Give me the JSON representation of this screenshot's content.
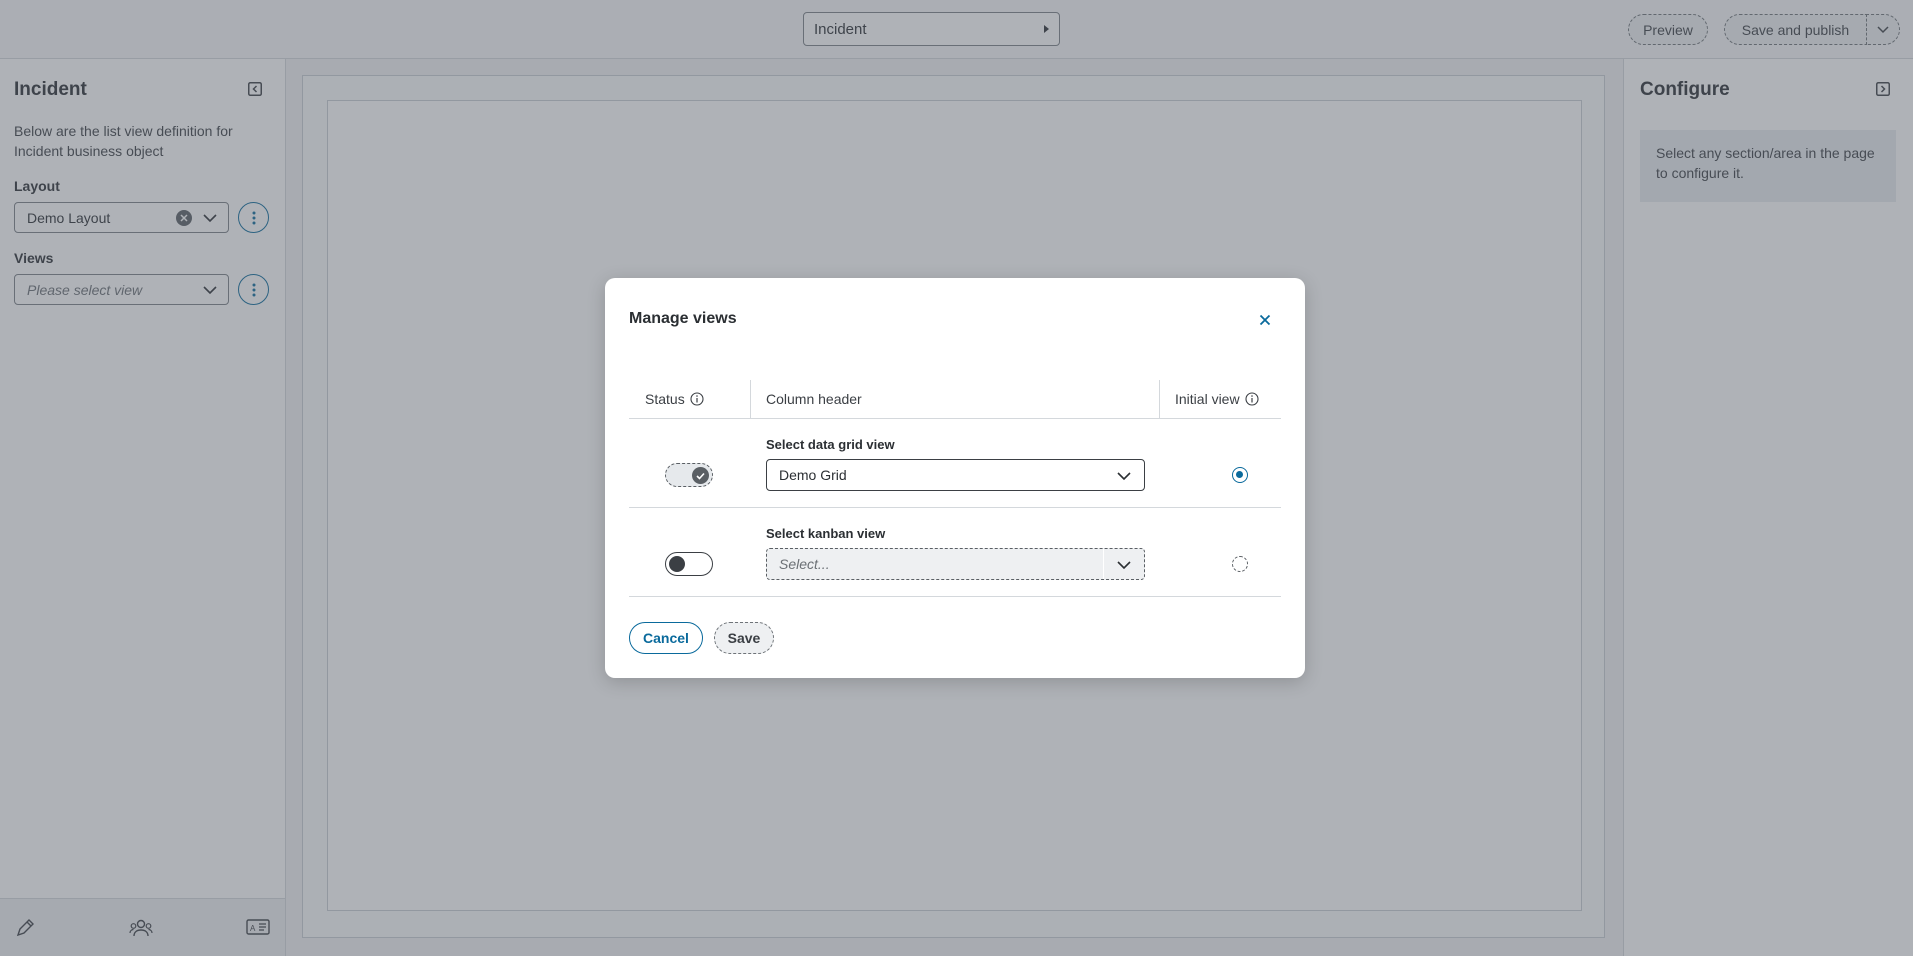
{
  "topbar": {
    "business_object": "Incident",
    "preview_label": "Preview",
    "publish_label": "Save and publish"
  },
  "left_panel": {
    "title": "Incident",
    "description": "Below are the list view definition for Incident business object",
    "layout_label": "Layout",
    "layout_value": "Demo Layout",
    "views_label": "Views",
    "views_placeholder": "Please select view"
  },
  "right_panel": {
    "title": "Configure",
    "hint": "Select any section/area in the page to configure it."
  },
  "modal": {
    "title": "Manage views",
    "columns": {
      "status": "Status",
      "column_header": "Column header",
      "initial_view": "Initial view"
    },
    "rows": [
      {
        "label": "Select data grid view",
        "value": "Demo Grid",
        "enabled": true,
        "initial": true
      },
      {
        "label": "Select kanban view",
        "placeholder": "Select...",
        "enabled": false,
        "initial": false
      }
    ],
    "cancel_label": "Cancel",
    "save_label": "Save"
  },
  "colors": {
    "accent": "#0a6a9c",
    "overlay": "#555c65"
  },
  "icons": {
    "left_footer": [
      "brush-icon",
      "users-icon",
      "id-card-icon"
    ]
  }
}
